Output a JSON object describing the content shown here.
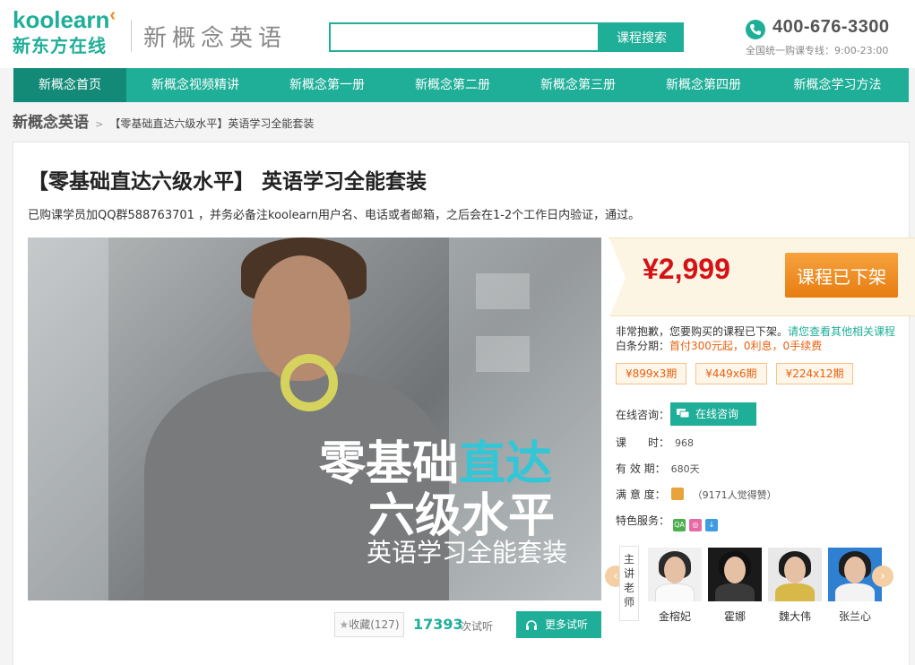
{
  "header": {
    "logo_en": "koolearn",
    "logo_cn": "新东方在线",
    "brand_title": "新概念英语",
    "search_placeholder": "",
    "search_button": "课程搜索",
    "phone_number": "400-676-3300",
    "phone_hours": "全国统一购课专线：9:00-23:00"
  },
  "nav": {
    "items": [
      {
        "label": "新概念首页",
        "active": true
      },
      {
        "label": "新概念视频精讲",
        "active": false
      },
      {
        "label": "新概念第一册",
        "active": false
      },
      {
        "label": "新概念第二册",
        "active": false
      },
      {
        "label": "新概念第三册",
        "active": false
      },
      {
        "label": "新概念第四册",
        "active": false
      },
      {
        "label": "新概念学习方法",
        "active": false
      }
    ]
  },
  "breadcrumb": {
    "root": "新概念英语",
    "sep": ">",
    "current": "【零基础直达六级水平】英语学习全能套装"
  },
  "course": {
    "title": "【零基础直达六级水平】 英语学习全能套装",
    "notice": "已购课学员加QQ群588763701 ，并务必备注koolearn用户名、电话或者邮箱，之后会在1-2个工作日内验证，通过。",
    "banner": {
      "line1a": "零基础",
      "line1b": "直达",
      "line2": "六级水平",
      "line3": "英语学习全能套装"
    },
    "favorite_label": "收藏(127)",
    "trial_count": "17393",
    "trial_label": "次试听",
    "more_trial": "更多试听"
  },
  "purchase": {
    "price": "¥2,999",
    "status": "课程已下架",
    "apology": "非常抱歉，您要购买的课程已下架。",
    "apology_link": "请您查看其他相关课程",
    "installment_label": "白条分期：",
    "installment_text": "首付300元起，0利息，0手续费",
    "plans": [
      "¥899x3期",
      "¥449x6期",
      "¥224x12期"
    ],
    "consult_label": "在线咨询：",
    "consult_button": "在线咨询",
    "hours_label": "课　　时：",
    "hours_value": "968",
    "validity_label": "有 效 期：",
    "validity_value": "680天",
    "satisfaction_label": "满 意 度：",
    "satisfaction_value": "（9171人觉得赞）",
    "services_label": "特色服务："
  },
  "teachers": {
    "label": "主讲老师",
    "list": [
      {
        "name": "金榕妃"
      },
      {
        "name": "霍娜"
      },
      {
        "name": "魏大伟"
      },
      {
        "name": "张兰心"
      }
    ]
  },
  "colors": {
    "brand": "#1fae98",
    "price": "#d41316",
    "orange": "#e67d11"
  }
}
